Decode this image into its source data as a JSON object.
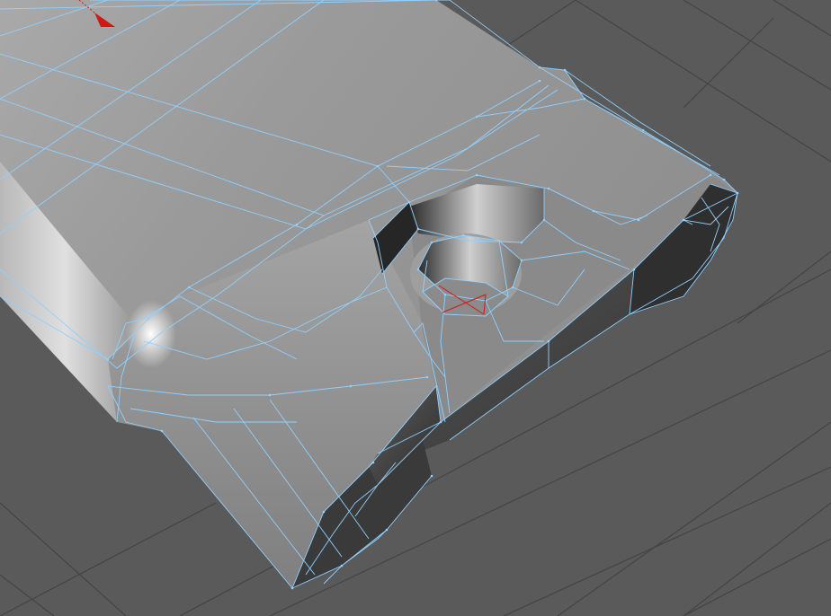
{
  "viewport": {
    "background_color": "#5a5a5a",
    "grid_color": "#444444",
    "wire_color": "#8fd0ff",
    "marker_color": "#d01818"
  }
}
